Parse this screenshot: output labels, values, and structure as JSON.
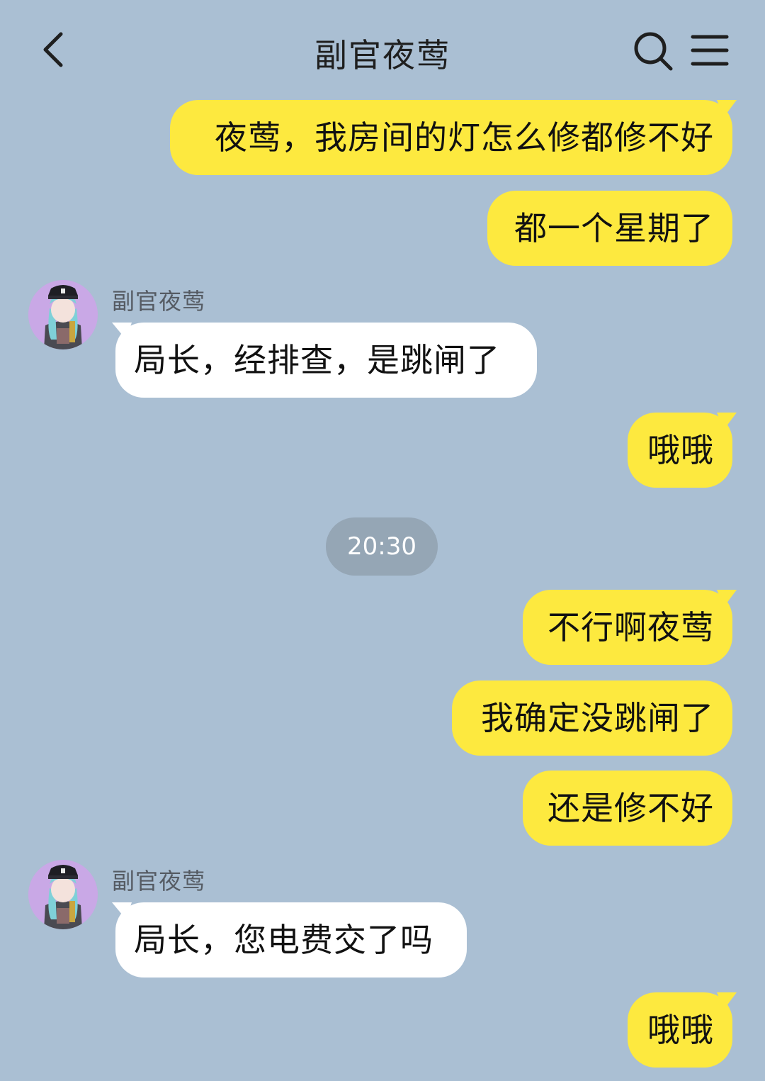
{
  "header": {
    "title": "副官夜莺",
    "back_icon": "chevron-left-icon",
    "search_icon": "search-icon",
    "menu_icon": "menu-icon"
  },
  "colors": {
    "background": "#aabfd3",
    "outgoing_bubble": "#fde93f",
    "incoming_bubble": "#ffffff",
    "time_pill": "#95a6b5"
  },
  "messages": [
    {
      "direction": "out",
      "text": "夜莺，我房间的灯怎么修都修不好"
    },
    {
      "direction": "out",
      "text": "都一个星期了"
    },
    {
      "direction": "in",
      "sender": "副官夜莺",
      "text": "局长，经排查，是跳闸了"
    },
    {
      "direction": "out",
      "text": "哦哦"
    },
    {
      "type": "timestamp",
      "text": "20:30"
    },
    {
      "direction": "out",
      "text": "不行啊夜莺"
    },
    {
      "direction": "out",
      "text": "我确定没跳闸了"
    },
    {
      "direction": "out",
      "text": "还是修不好"
    },
    {
      "direction": "in",
      "sender": "副官夜莺",
      "text": "局长，您电费交了吗"
    },
    {
      "direction": "out",
      "text": "哦哦"
    }
  ]
}
